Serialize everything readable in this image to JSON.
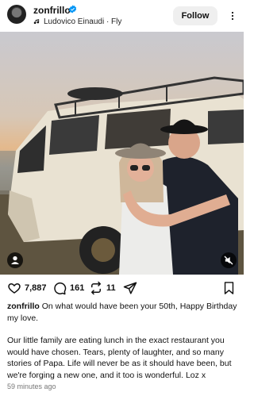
{
  "post": {
    "username": "zonfrillo",
    "verified": true,
    "audio": "Ludovico Einaudi · Fly",
    "follow_label": "Follow"
  },
  "actions": {
    "likes": "7,887",
    "comments": "161",
    "reposts": "11"
  },
  "caption": {
    "username": "zonfrillo",
    "line1": "On what would have been your 50th, Happy Birthday my love.",
    "line2": "Our little family are eating lunch in the exact restaurant you would have chosen. Tears, plenty of laughter, and so many stories of Papa. Life will never be as it should have been, but we're forging a new one, and it too is wonderful. Loz x"
  },
  "timestamp": "59 minutes ago",
  "colors": {
    "verified": "#0095f6",
    "follow_bg": "#efefef"
  },
  "icons": {
    "verified": "verified-badge-icon",
    "music": "music-note-icon",
    "more": "more-options-icon",
    "like": "heart-icon",
    "comment": "comment-icon",
    "repost": "repost-icon",
    "share": "share-icon",
    "save": "bookmark-icon",
    "tag": "user-tag-icon",
    "mute": "muted-speaker-icon"
  }
}
